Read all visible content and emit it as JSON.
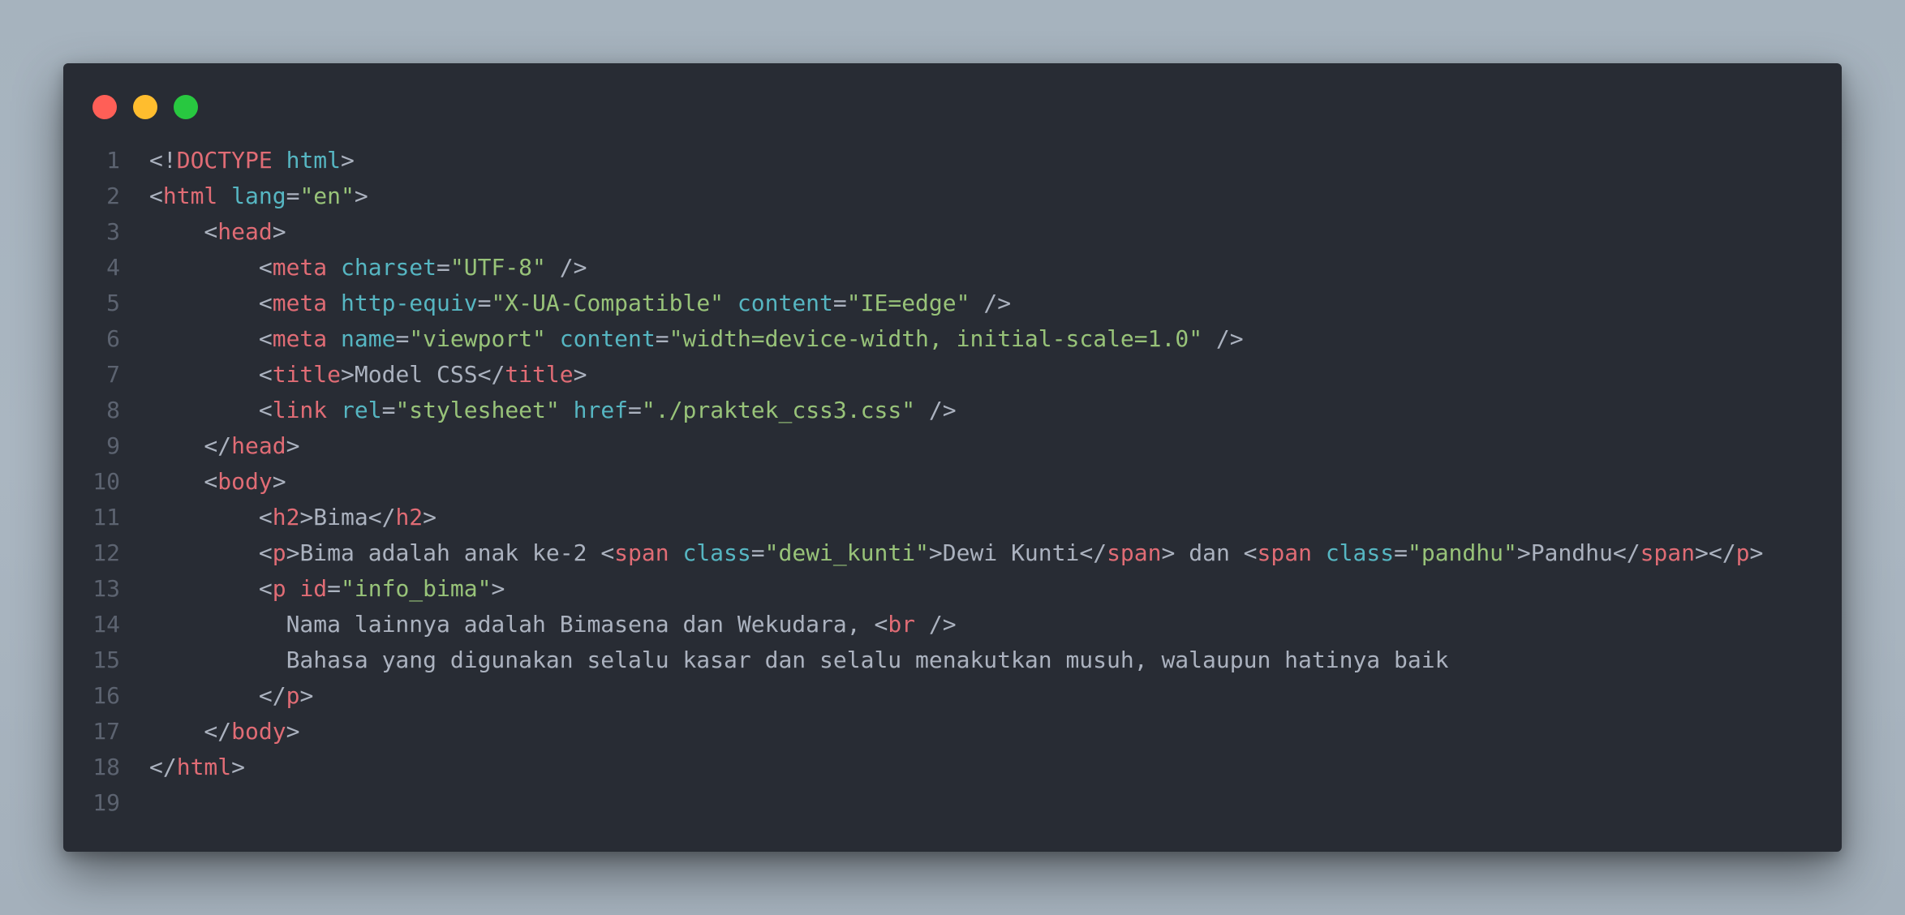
{
  "colors": {
    "page_background": "#a8b4bf",
    "window_background": "#282c34",
    "close": "#ff5f57",
    "minimize": "#ffbd2e",
    "maximize": "#28c840",
    "punct": "#abb2bf",
    "tag": "#e06c75",
    "attr": "#56b6c2",
    "string": "#98c379",
    "text": "#abb2bf",
    "line_number": "#5c6370"
  },
  "window_controls": [
    {
      "name": "close-button",
      "color": "#ff5f57"
    },
    {
      "name": "minimize-button",
      "color": "#ffbd2e"
    },
    {
      "name": "maximize-button",
      "color": "#28c840"
    }
  ],
  "code_lines": [
    {
      "n": "1",
      "tokens": [
        [
          "p",
          "<!"
        ],
        [
          "k",
          "DOCTYPE"
        ],
        [
          "p",
          " "
        ],
        [
          "a",
          "html"
        ],
        [
          "p",
          ">"
        ]
      ]
    },
    {
      "n": "2",
      "tokens": [
        [
          "p",
          "<"
        ],
        [
          "k",
          "html"
        ],
        [
          "p",
          " "
        ],
        [
          "a",
          "lang"
        ],
        [
          "p",
          "="
        ],
        [
          "s",
          "\"en\""
        ],
        [
          "p",
          ">"
        ]
      ]
    },
    {
      "n": "3",
      "tokens": [
        [
          "p",
          "    <"
        ],
        [
          "k",
          "head"
        ],
        [
          "p",
          ">"
        ]
      ]
    },
    {
      "n": "4",
      "tokens": [
        [
          "p",
          "        <"
        ],
        [
          "k",
          "meta"
        ],
        [
          "p",
          " "
        ],
        [
          "a",
          "charset"
        ],
        [
          "p",
          "="
        ],
        [
          "s",
          "\"UTF-8\""
        ],
        [
          "p",
          " />"
        ]
      ]
    },
    {
      "n": "5",
      "tokens": [
        [
          "p",
          "        <"
        ],
        [
          "k",
          "meta"
        ],
        [
          "p",
          " "
        ],
        [
          "a",
          "http-equiv"
        ],
        [
          "p",
          "="
        ],
        [
          "s",
          "\"X-UA-Compatible\""
        ],
        [
          "p",
          " "
        ],
        [
          "a",
          "content"
        ],
        [
          "p",
          "="
        ],
        [
          "s",
          "\"IE=edge\""
        ],
        [
          "p",
          " />"
        ]
      ]
    },
    {
      "n": "6",
      "tokens": [
        [
          "p",
          "        <"
        ],
        [
          "k",
          "meta"
        ],
        [
          "p",
          " "
        ],
        [
          "a",
          "name"
        ],
        [
          "p",
          "="
        ],
        [
          "s",
          "\"viewport\""
        ],
        [
          "p",
          " "
        ],
        [
          "a",
          "content"
        ],
        [
          "p",
          "="
        ],
        [
          "s",
          "\"width=device-width, initial-scale=1.0\""
        ],
        [
          "p",
          " />"
        ]
      ]
    },
    {
      "n": "7",
      "tokens": [
        [
          "p",
          "        <"
        ],
        [
          "k",
          "title"
        ],
        [
          "p",
          ">"
        ],
        [
          "t",
          "Model CSS"
        ],
        [
          "p",
          "</"
        ],
        [
          "k",
          "title"
        ],
        [
          "p",
          ">"
        ]
      ]
    },
    {
      "n": "8",
      "tokens": [
        [
          "p",
          "        <"
        ],
        [
          "k",
          "link"
        ],
        [
          "p",
          " "
        ],
        [
          "a",
          "rel"
        ],
        [
          "p",
          "="
        ],
        [
          "s",
          "\"stylesheet\""
        ],
        [
          "p",
          " "
        ],
        [
          "a",
          "href"
        ],
        [
          "p",
          "="
        ],
        [
          "s",
          "\"./praktek_css3.css\""
        ],
        [
          "p",
          " />"
        ]
      ]
    },
    {
      "n": "9",
      "tokens": [
        [
          "p",
          "    </"
        ],
        [
          "k",
          "head"
        ],
        [
          "p",
          ">"
        ]
      ]
    },
    {
      "n": "10",
      "tokens": [
        [
          "p",
          "    <"
        ],
        [
          "k",
          "body"
        ],
        [
          "p",
          ">"
        ]
      ]
    },
    {
      "n": "11",
      "tokens": [
        [
          "p",
          "        <"
        ],
        [
          "k",
          "h2"
        ],
        [
          "p",
          ">"
        ],
        [
          "t",
          "Bima"
        ],
        [
          "p",
          "</"
        ],
        [
          "k",
          "h2"
        ],
        [
          "p",
          ">"
        ]
      ]
    },
    {
      "n": "12",
      "tokens": [
        [
          "p",
          "        <"
        ],
        [
          "k",
          "p"
        ],
        [
          "p",
          ">"
        ],
        [
          "t",
          "Bima adalah anak ke-2 "
        ],
        [
          "p",
          "<"
        ],
        [
          "k",
          "span"
        ],
        [
          "p",
          " "
        ],
        [
          "a",
          "class"
        ],
        [
          "p",
          "="
        ],
        [
          "s",
          "\"dewi_kunti\""
        ],
        [
          "p",
          ">"
        ],
        [
          "t",
          "Dewi Kunti"
        ],
        [
          "p",
          "</"
        ],
        [
          "k",
          "span"
        ],
        [
          "p",
          "> "
        ],
        [
          "t",
          "dan "
        ],
        [
          "p",
          "<"
        ],
        [
          "k",
          "span"
        ],
        [
          "p",
          " "
        ],
        [
          "a",
          "class"
        ],
        [
          "p",
          "="
        ],
        [
          "s",
          "\"pandhu\""
        ],
        [
          "p",
          ">"
        ],
        [
          "t",
          "Pandhu"
        ],
        [
          "p",
          "</"
        ],
        [
          "k",
          "span"
        ],
        [
          "p",
          "></"
        ],
        [
          "k",
          "p"
        ],
        [
          "p",
          ">"
        ]
      ]
    },
    {
      "n": "13",
      "tokens": [
        [
          "p",
          "        <"
        ],
        [
          "k",
          "p"
        ],
        [
          "p",
          " "
        ],
        [
          "k",
          "id"
        ],
        [
          "p",
          "="
        ],
        [
          "s",
          "\"info_bima\""
        ],
        [
          "p",
          ">"
        ]
      ]
    },
    {
      "n": "14",
      "tokens": [
        [
          "t",
          "          Nama lainnya adalah Bimasena dan Wekudara, "
        ],
        [
          "p",
          "<"
        ],
        [
          "k",
          "br"
        ],
        [
          "p",
          " />"
        ]
      ]
    },
    {
      "n": "15",
      "tokens": [
        [
          "t",
          "          Bahasa yang digunakan selalu kasar dan selalu menakutkan musuh, walaupun hatinya baik"
        ]
      ]
    },
    {
      "n": "16",
      "tokens": [
        [
          "p",
          "        </"
        ],
        [
          "k",
          "p"
        ],
        [
          "p",
          ">"
        ]
      ]
    },
    {
      "n": "17",
      "tokens": [
        [
          "p",
          "    </"
        ],
        [
          "k",
          "body"
        ],
        [
          "p",
          ">"
        ]
      ]
    },
    {
      "n": "18",
      "tokens": [
        [
          "p",
          "</"
        ],
        [
          "k",
          "html"
        ],
        [
          "p",
          ">"
        ]
      ]
    },
    {
      "n": "19",
      "tokens": []
    }
  ]
}
